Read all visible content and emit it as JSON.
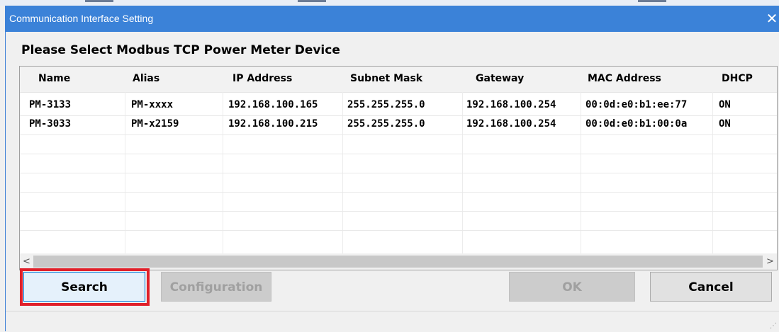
{
  "window": {
    "title": "Communication Interface Setting",
    "close_icon": "close-icon",
    "title_bar_color": "#3b82d8"
  },
  "heading": "Please Select Modbus TCP Power Meter Device",
  "table": {
    "columns": [
      "Name",
      "Alias",
      "IP Address",
      "Subnet Mask",
      "Gateway",
      "MAC Address",
      "DHCP"
    ],
    "rows": [
      [
        "PM-3133",
        "PM-xxxx",
        "192.168.100.165",
        "255.255.255.0",
        "192.168.100.254",
        "00:0d:e0:b1:ee:77",
        "ON"
      ],
      [
        "PM-3033",
        "PM-x2159",
        "192.168.100.215",
        "255.255.255.0",
        "192.168.100.254",
        "00:0d:e0:b1:00:0a",
        "ON"
      ]
    ]
  },
  "scrollbar": {
    "left_arrow": "<",
    "right_arrow": ">"
  },
  "buttons": {
    "search": "Search",
    "configuration": "Configuration",
    "ok": "OK",
    "cancel": "Cancel"
  },
  "highlight_color": "#e0202a"
}
